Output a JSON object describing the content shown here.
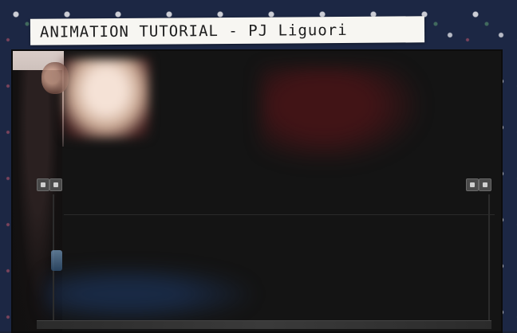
{
  "title_strip": {
    "text": "ANIMATION TUTORIAL - PJ Liguori"
  },
  "scene": {
    "background": "floral-wallpaper",
    "colors": {
      "wallpaper": "#1c2744",
      "screen": "#141414",
      "strip": "#f7f6f2"
    }
  }
}
